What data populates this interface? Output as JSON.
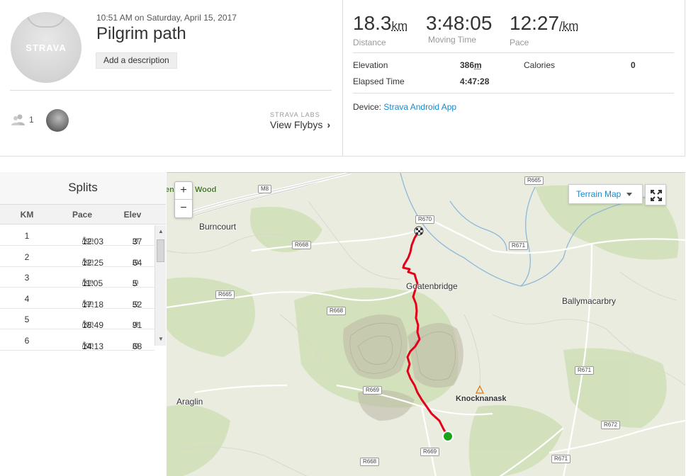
{
  "activity": {
    "datetime": "10:51 AM on Saturday, April 15, 2017",
    "title": "Pilgrim path",
    "add_description": "Add a description",
    "avatar_text": "STRAVA",
    "kudos_count": "1"
  },
  "flybys": {
    "labs": "STRAVA LABS",
    "label": "View Flybys"
  },
  "stats": {
    "distance": {
      "value": "18.3",
      "unit": "km",
      "label": "Distance"
    },
    "moving_time": {
      "value": "3:48:05",
      "label": "Moving Time"
    },
    "pace": {
      "value": "12:27",
      "unit": "/km",
      "label": "Pace"
    },
    "elevation_label": "Elevation",
    "elevation_value": "386",
    "elevation_unit": "m",
    "calories_label": "Calories",
    "calories_value": "0",
    "elapsed_label": "Elapsed Time",
    "elapsed_value": "4:47:28",
    "device_label": "Device:",
    "device_value": "Strava Android App"
  },
  "splits": {
    "title": "Splits",
    "headers": [
      "KM",
      "Pace",
      "Elev"
    ],
    "rows": [
      {
        "km": "1",
        "pace": "12:03",
        "pace_unit": "/km",
        "elev": "37",
        "elev_unit": "m"
      },
      {
        "km": "2",
        "pace": "12:25",
        "pace_unit": "/km",
        "elev": "64",
        "elev_unit": "m"
      },
      {
        "km": "3",
        "pace": "11:05",
        "pace_unit": "/km",
        "elev": "5",
        "elev_unit": "m"
      },
      {
        "km": "4",
        "pace": "17:18",
        "pace_unit": "/km",
        "elev": "52",
        "elev_unit": "m"
      },
      {
        "km": "5",
        "pace": "18:49",
        "pace_unit": "/km",
        "elev": "91",
        "elev_unit": "m"
      },
      {
        "km": "6",
        "pace": "14:13",
        "pace_unit": "/km",
        "elev": "68",
        "elev_unit": "m"
      }
    ]
  },
  "map": {
    "zoom_in": "+",
    "zoom_out": "−",
    "map_type": "Terrain Map",
    "places": {
      "wood": "Wood",
      "burncourt": "Burncourt",
      "goatenbridge": "Goatenbridge",
      "ballymacarbry": "Ballymacarbry",
      "araglin": "Araglin",
      "knocknanask": "Knocknanask",
      "en": "en"
    },
    "roads": {
      "m8": "M8",
      "r665a": "R665",
      "r670": "R670",
      "r668a": "R668",
      "r671a": "R671",
      "r665b": "R665",
      "r668b": "R668",
      "r669a": "R669",
      "r671b": "R671",
      "r672": "R672",
      "r669b": "R669",
      "r668c": "R668",
      "r671c": "R671"
    },
    "colors": {
      "route": "#e2001a",
      "start": "#1aa31a"
    }
  }
}
